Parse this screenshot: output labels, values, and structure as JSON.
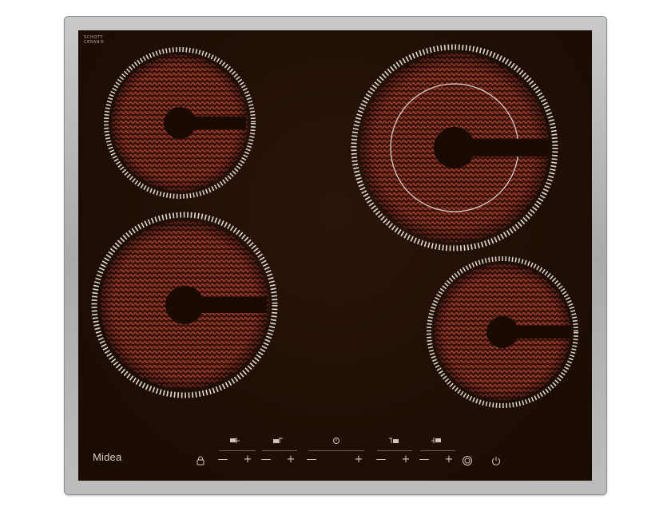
{
  "glass_label": {
    "line1": "SCHOTT",
    "line2": "CERAN®"
  },
  "brand": {
    "name": "idea",
    "logo_letter": "M"
  },
  "controls": {
    "minus_symbol": "—",
    "plus_symbol": "+",
    "zone_icons": [
      "zone-front-left-icon",
      "zone-rear-left-icon",
      "timer-icon",
      "zone-rear-right-icon",
      "zone-front-right-icon"
    ],
    "lock_icon": "lock-icon",
    "boost_icon": "double-ring-icon",
    "power_icon": "power-icon"
  },
  "colors": {
    "glass": "#1f0e05",
    "frame": "#b5b5b5",
    "coil": "#9e3a2e",
    "coil_hot": "#c25447",
    "rim_tick": "#d8d4d0",
    "text": "#cfc4bb"
  }
}
